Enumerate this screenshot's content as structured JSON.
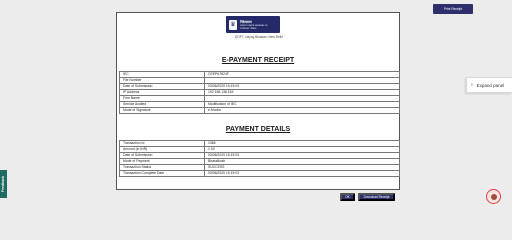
{
  "toolbar": {
    "print_label": "Print Receipt"
  },
  "logo": {
    "line1": "निदेशालय",
    "line2": "DIRECTORATE GENERAL OF",
    "line3": "FOREIGN TRADE",
    "emblem_icon": "national-emblem"
  },
  "address": "DGFT, Udyog Bhawan, New Delhi",
  "epayment": {
    "title": "E-PAYMENT RECEIPT",
    "rows": [
      {
        "label": "IEC",
        "value": "CEEPA7824F"
      },
      {
        "label": "File Number",
        "value": ""
      },
      {
        "label": "Date of Submission",
        "value": "03/06/2020 15:19:03"
      },
      {
        "label": "IP Address",
        "value": "192.168.136.184"
      },
      {
        "label": "Firm Name",
        "value": ""
      },
      {
        "label": "Service Availed",
        "value": "Modification of IEC"
      },
      {
        "label": "Mode of Signature",
        "value": "e-Mudra"
      }
    ]
  },
  "payment": {
    "title": "PAYMENT DETAILS",
    "rows": [
      {
        "label": "Transaction Id",
        "value": "1366"
      },
      {
        "label": "Amount (in INR)",
        "value": "1.00"
      },
      {
        "label": "Date of Submission",
        "value": "03/06/2020 15:19:03"
      },
      {
        "label": "Mode of Payment",
        "value": "Bharatkosh"
      },
      {
        "label": "Transaction Status",
        "value": "SUCCESS"
      },
      {
        "label": "Transaction Complete Date",
        "value": "03/06/2020 15:19:03"
      }
    ]
  },
  "buttons": {
    "ok_label": "OK",
    "download_label": "Download Receipt"
  },
  "side_panel": {
    "expand_label": "Expand panel",
    "chevron_icon": "chevron-right"
  },
  "feedback": {
    "label": "Feedback"
  },
  "colors": {
    "primary": "#2f2f6e",
    "logo_bg": "#242a68",
    "feedback_bg": "#1e6b63"
  }
}
